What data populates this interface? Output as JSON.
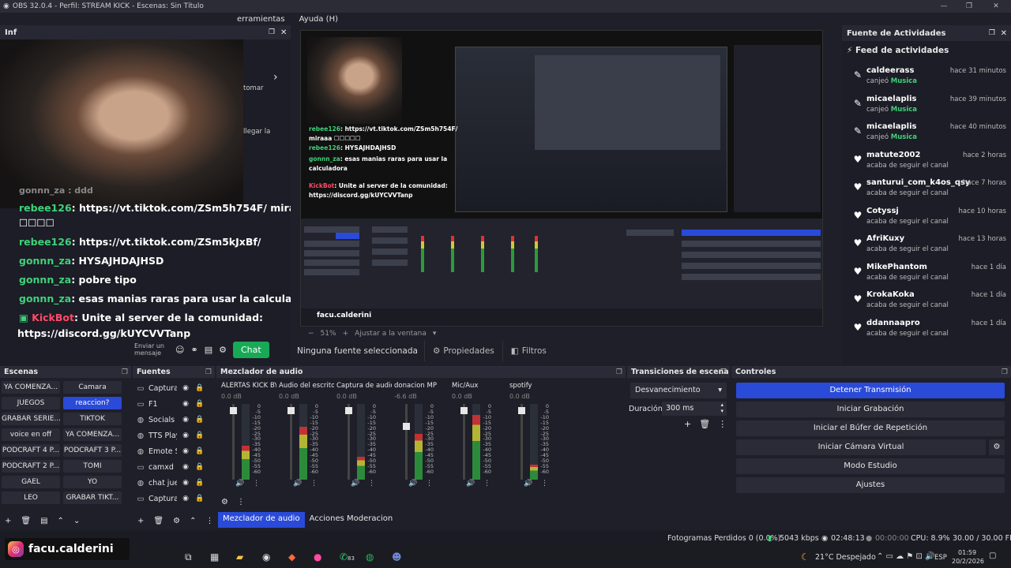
{
  "titlebar": {
    "text": "OBS 32.0.4 - Perfil: STREAM KICK - Escenas: Sin Título",
    "min": "—",
    "max": "❐",
    "close": "✕"
  },
  "menubar": {
    "items": [
      "erramientas",
      "Ayuda (H)"
    ]
  },
  "chat_dock": {
    "title": "Inf",
    "messages": [
      {
        "user": "rebee126",
        "text": ": https://vt.tiktok.com/ZSm5h754F/ miraaa ☐"
      },
      {
        "user": "",
        "text": "☐☐☐☐"
      },
      {
        "user": "rebee126",
        "text": ": https://vt.tiktok.com/ZSm5kJxBf/"
      },
      {
        "user": "gonnn_za",
        "text": ": HYSAJHDAJHSD"
      },
      {
        "user": "gonnn_za",
        "text": ": pobre tipo"
      },
      {
        "user": "gonnn_za",
        "text": ": esas manias raras para usar la calculadora"
      },
      {
        "user": "KickBot",
        "text": ": Unite al server de la comunidad:"
      },
      {
        "user": "",
        "text": "https://discord.gg/kUYCVVTanp"
      }
    ],
    "partial_text": "gonnn_za : ddd",
    "tomar": "tomar",
    "llegar": "llegar la",
    "input_placeholder": "Enviar un mensaje",
    "chat_button": "Chat"
  },
  "preview": {
    "chat_lines": [
      {
        "user": "rebee126",
        "text": ": https://vt.tiktok.com/ZSm5h754F/"
      },
      {
        "user": "",
        "text": "miraaa ☐☐☐☐☐"
      },
      {
        "user": "rebee126",
        "text": ": HYSAJHDAJHSD"
      },
      {
        "user": "gonnn_za",
        "text": ": esas manias raras para usar la"
      },
      {
        "user": "",
        "text": "calculadora"
      },
      {
        "user": "KickBot",
        "text": ": Unite al server de la comunidad:"
      },
      {
        "user": "",
        "text": "https://discord.gg/kUYCVVTanp"
      }
    ],
    "overlay_name": "facu.calderini"
  },
  "preview_bar": {
    "zoom": "51%",
    "fit": "Ajustar a la ventana"
  },
  "source_bar": {
    "no_source": "Ninguna fuente seleccionada",
    "properties": "Propiedades",
    "filters": "Filtros"
  },
  "feed": {
    "dock_title": "Fuente de Actividades",
    "title": "Feed de actividades",
    "items": [
      {
        "icon": "paint-icon",
        "name": "caldeerass",
        "sub": "canjeó",
        "reward": "Musica",
        "time": "hace 31 minutos"
      },
      {
        "icon": "paint-icon",
        "name": "micaelaplis",
        "sub": "canjeó",
        "reward": "Musica",
        "time": "hace 39 minutos"
      },
      {
        "icon": "paint-icon",
        "name": "micaelaplis",
        "sub": "canjeó",
        "reward": "Musica",
        "time": "hace 40 minutos"
      },
      {
        "icon": "heart-icon",
        "name": "matute2002",
        "sub": "acaba de seguir el canal",
        "reward": "",
        "time": "hace 2 horas"
      },
      {
        "icon": "heart-icon",
        "name": "santurui_com_k4os_qsy",
        "sub": "acaba de seguir el canal",
        "reward": "",
        "time": "hace 7 horas"
      },
      {
        "icon": "heart-icon",
        "name": "Cotyssj",
        "sub": "acaba de seguir el canal",
        "reward": "",
        "time": "hace 10 horas"
      },
      {
        "icon": "heart-icon",
        "name": "AfriKuxy",
        "sub": "acaba de seguir el canal",
        "reward": "",
        "time": "hace 13 horas"
      },
      {
        "icon": "heart-icon",
        "name": "MikePhantom",
        "sub": "acaba de seguir el canal",
        "reward": "",
        "time": "hace 1 día"
      },
      {
        "icon": "heart-icon",
        "name": "KrokaKoka",
        "sub": "acaba de seguir el canal",
        "reward": "",
        "time": "hace 1 día"
      },
      {
        "icon": "heart-icon",
        "name": "ddannaapro",
        "sub": "acaba de seguir el canal",
        "reward": "",
        "time": "hace 1 día"
      }
    ]
  },
  "scenes": {
    "title": "Escenas",
    "items": [
      "YA COMENZA...",
      "Camara",
      "JUEGOS",
      "reaccion?",
      "GRABAR SERIE...",
      "TIKTOK",
      "voice en off",
      "YA COMENZA...",
      "PODCRAFT 4 P...",
      "PODCRAFT 3 P...",
      "PODCRAFT 2 P...",
      "TOMI",
      "GAEL",
      "YO",
      "LEO",
      "GRABAR TIKT..."
    ],
    "selected": "reaccion?"
  },
  "sources": {
    "title": "Fuentes",
    "items": [
      "Captura",
      "F1",
      "Socials C",
      "TTS Play",
      "Emote S",
      "camxd",
      "chat jueg",
      "Captura"
    ]
  },
  "mixer": {
    "title": "Mezclador de audio",
    "channels": [
      {
        "name": "ALERTAS KICK BY S",
        "db": "0.0 dB",
        "level": 0.45
      },
      {
        "name": "Audio del escritorio",
        "db": "0.0 dB",
        "level": 0.7
      },
      {
        "name": "Captura de audio c",
        "db": "0.0 dB",
        "level": 0.3
      },
      {
        "name": "donacion MP",
        "db": "-6.6 dB",
        "level": 0.6
      },
      {
        "name": "Mic/Aux",
        "db": "0.0 dB",
        "level": 0.85
      },
      {
        "name": "spotify",
        "db": "0.0 dB",
        "level": 0.2
      }
    ],
    "scale": [
      "0",
      "-5",
      "-10",
      "-15",
      "-20",
      "-25",
      "-30",
      "-35",
      "-40",
      "-45",
      "-50",
      "-55",
      "-60"
    ],
    "tabs": [
      "Mezclador de audio",
      "Acciones Moderacion"
    ]
  },
  "transitions": {
    "title": "Transiciones de escena",
    "selected": "Desvanecimiento",
    "duration_label": "Duración",
    "duration_value": "300 ms"
  },
  "controls": {
    "title": "Controles",
    "buttons": [
      "Detener Transmisión",
      "Iniciar Grabación",
      "Iniciar el Búfer de Repetición",
      "Iniciar Cámara Virtual",
      "Modo Estudio",
      "Ajustes"
    ]
  },
  "status": {
    "dropped": "Fotogramas Perdidos 0 (0.0%)",
    "bitrate": "5043 kbps",
    "live_time": "02:48:13",
    "rec_time": "00:00:00",
    "cpu": "CPU: 8.9%",
    "fps": "30.00 / 30.00 FPS"
  },
  "taskbar": {
    "search": "Buscar",
    "weather": "21°C  Despejado",
    "lang": "ESP",
    "time": "01:59",
    "date": "20/2/2026",
    "badge": "83"
  },
  "ig_badge": {
    "name": "facu.calderini"
  },
  "colors": {
    "accent": "#2a4ad8",
    "chat_user": "#3fd17a",
    "bot": "#ff4a6a",
    "bg": "#1e1f29"
  }
}
